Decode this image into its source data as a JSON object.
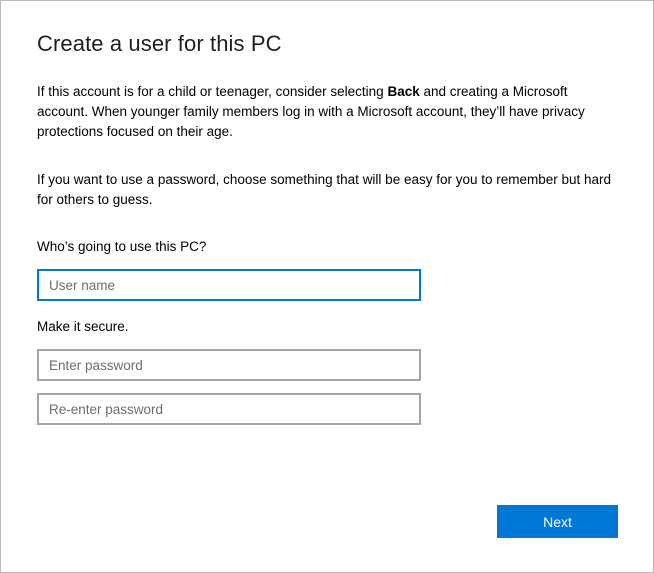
{
  "dialog": {
    "title": "Create a user for this PC",
    "para1": {
      "before": "If this account is for a child or teenager, consider selecting ",
      "bold": "Back",
      "after": " and creating a Microsoft account. When younger family members log in with a Microsoft account, they’ll have privacy protections focused on their age."
    },
    "para2": "If you want to use a password, choose something that will be easy for you to remember but hard for others to guess.",
    "who_label": "Who’s going to use this PC?",
    "username_placeholder": "User name",
    "secure_label": "Make it secure.",
    "password_placeholder": "Enter password",
    "reenter_placeholder": "Re-enter password",
    "next_label": "Next"
  },
  "colors": {
    "accent": "#0078d7",
    "field_border": "#a6a6a6",
    "dialog_border": "#b9b9b9"
  }
}
